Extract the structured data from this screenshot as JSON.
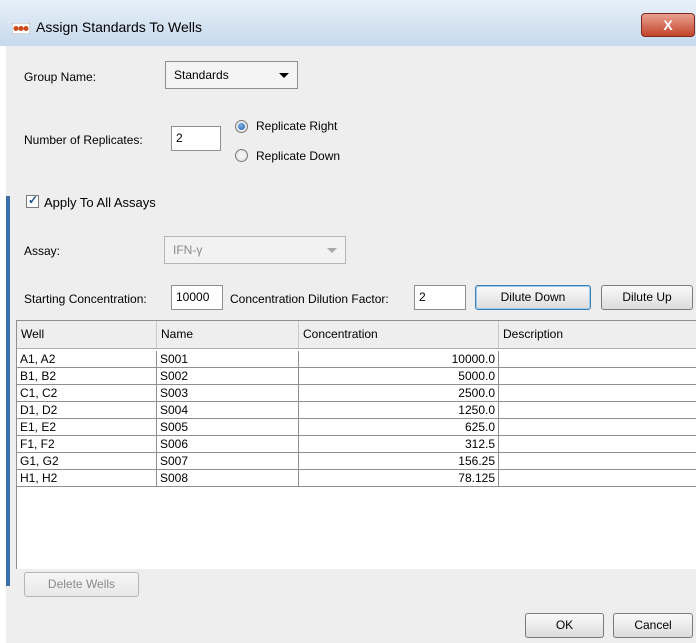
{
  "window": {
    "title": "Assign Standards To Wells",
    "close_label": "X"
  },
  "form": {
    "group_name_label": "Group Name:",
    "group_name_value": "Standards",
    "replicates_label": "Number of Replicates:",
    "replicates_value": "2",
    "replicate_right_label": "Replicate Right",
    "replicate_down_label": "Replicate Down",
    "replicate_selected": "Replicate Right",
    "apply_all_label": "Apply To All Assays",
    "apply_all_checked": true,
    "assay_label": "Assay:",
    "assay_value": "IFN-γ",
    "starting_conc_label": "Starting Concentration:",
    "starting_conc_value": "10000",
    "dilution_factor_label": "Concentration Dilution Factor:",
    "dilution_factor_value": "2",
    "dilute_down_label": "Dilute Down",
    "dilute_up_label": "Dilute Up"
  },
  "table": {
    "columns": [
      "Well",
      "Name",
      "Concentration",
      "Description"
    ],
    "rows": [
      {
        "well": "A1, A2",
        "name": "S001",
        "concentration": "10000.0",
        "description": ""
      },
      {
        "well": "B1, B2",
        "name": "S002",
        "concentration": "5000.0",
        "description": ""
      },
      {
        "well": "C1, C2",
        "name": "S003",
        "concentration": "2500.0",
        "description": ""
      },
      {
        "well": "D1, D2",
        "name": "S004",
        "concentration": "1250.0",
        "description": ""
      },
      {
        "well": "E1, E2",
        "name": "S005",
        "concentration": "625.0",
        "description": ""
      },
      {
        "well": "F1, F2",
        "name": "S006",
        "concentration": "312.5",
        "description": ""
      },
      {
        "well": "G1, G2",
        "name": "S007",
        "concentration": "156.25",
        "description": ""
      },
      {
        "well": "H1, H2",
        "name": "S008",
        "concentration": "78.125",
        "description": ""
      }
    ]
  },
  "buttons": {
    "delete_wells": "Delete Wells",
    "ok": "OK",
    "cancel": "Cancel"
  },
  "colors": {
    "titlebar": "#c7d9ec",
    "dialog_bg": "#eeeeee",
    "close_button": "#c3442c",
    "radio_selected": "#1c5fa8"
  }
}
